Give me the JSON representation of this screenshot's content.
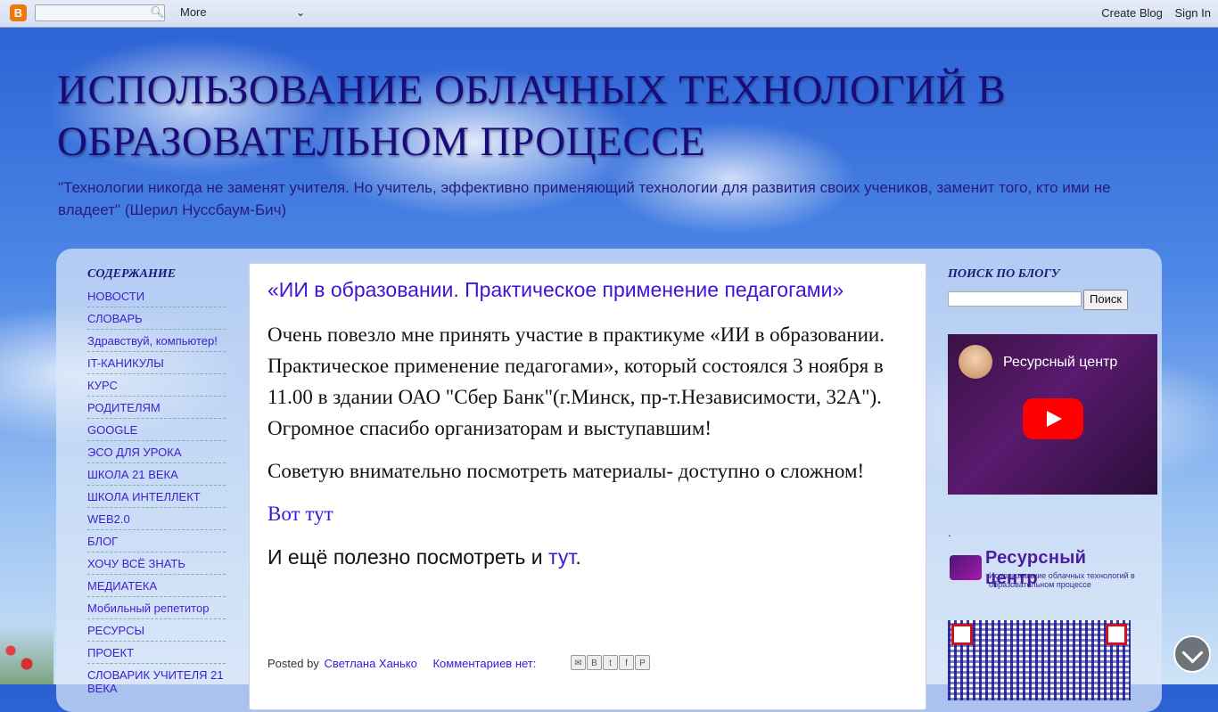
{
  "navbar": {
    "more_label": "More",
    "create_blog": "Create Blog",
    "sign_in": "Sign In"
  },
  "header": {
    "title": "ИСПОЛЬЗОВАНИЕ ОБЛАЧНЫХ ТЕХНОЛОГИЙ В ОБРАЗОВАТЕЛЬНОМ ПРОЦЕССЕ",
    "description": "\"Технологии никогда не заменят учителя. Но учитель, эффективно применяющий технологии для развития своих учеников, заменит того, кто ими не владеет\" (Шерил Нуссбаум-Бич)"
  },
  "sidebar": {
    "title": "СОДЕРЖАНИЕ",
    "items": [
      {
        "label": "НОВОСТИ"
      },
      {
        "label": "СЛОВАРЬ"
      },
      {
        "label": "Здравствуй, компьютер!"
      },
      {
        "label": "IT-КАНИКУЛЫ"
      },
      {
        "label": "КУРС"
      },
      {
        "label": "РОДИТЕЛЯМ"
      },
      {
        "label": "GOOGLE"
      },
      {
        "label": "ЭСО ДЛЯ УРОКА"
      },
      {
        "label": "ШКОЛА 21 ВЕКА"
      },
      {
        "label": "ШКОЛА ИНТЕЛЛЕКТ"
      },
      {
        "label": "WEB2.0"
      },
      {
        "label": "БЛОГ"
      },
      {
        "label": "ХОЧУ ВСЁ ЗНАТЬ"
      },
      {
        "label": "МЕДИАТЕКА"
      },
      {
        "label": "Мобильный репетитор"
      },
      {
        "label": "РЕСУРСЫ"
      },
      {
        "label": "ПРОЕКТ"
      },
      {
        "label": "СЛОВАРИК УЧИТЕЛЯ 21 ВЕКА"
      }
    ]
  },
  "post": {
    "title": "«ИИ в образовании. Практическое применение педагогами»",
    "paragraph1": "Очень повезло мне принять участие в практикуме «ИИ в образовании. Практическое применение педагогами», который состоялся 3 ноября в 11.00 в здании ОАО \"Сбер Банк\"(г.Минск, пр-т.Независимости, 32А\"). Огромное спасибо организаторам и выступавшим!",
    "paragraph2": "Советую внимательно посмотреть материалы- доступно о сложном!",
    "link1": "Вот тут",
    "paragraph3_prefix": "И ещё полезно посмотреть и ",
    "link2": "тут",
    "paragraph3_suffix": ".",
    "posted_by": "Posted by",
    "author": "Светлана Ханько",
    "comments": "Комментариев нет:"
  },
  "right_sidebar": {
    "search_title": "ПОИСК ПО БЛОГУ",
    "search_button": "Поиск",
    "video_title": "Ресурсный центр",
    "dot": ".",
    "logo_name": "Ресурсный центр",
    "logo_subtitle": "Использование облачных технологий в образовательном процессе"
  }
}
